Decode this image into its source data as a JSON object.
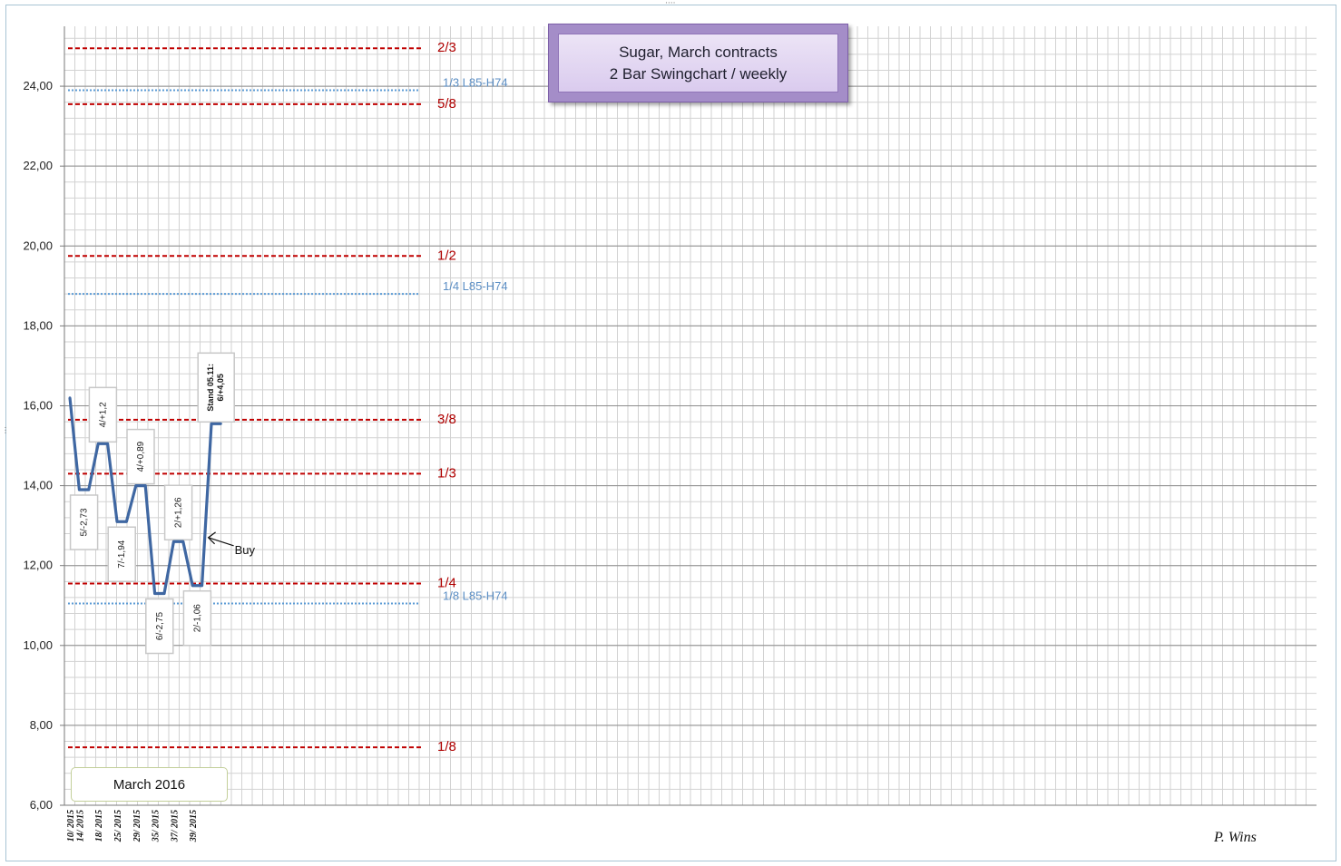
{
  "chart_data": {
    "type": "line",
    "title": "Sugar, March contracts",
    "subtitle": "2 Bar Swingchart / weekly",
    "contract_label": "March 2016",
    "author": "P. Wins",
    "xlabel": "",
    "ylabel": "",
    "ylim": [
      6,
      25.5
    ],
    "y_ticks": [
      "6,00",
      "8,00",
      "10,00",
      "12,00",
      "14,00",
      "16,00",
      "18,00",
      "20,00",
      "22,00",
      "24,00"
    ],
    "y_tick_values": [
      6,
      8,
      10,
      12,
      14,
      16,
      18,
      20,
      22,
      24
    ],
    "x_labels": [
      "10/ 2015",
      "14/ 2015",
      "18/ 2015",
      "25/ 2015",
      "29/ 2015",
      "35/ 2015",
      "37/ 2015",
      "39/ 2015"
    ],
    "x_label_index": [
      0,
      1,
      3,
      5,
      7,
      9,
      11,
      13
    ],
    "grid": true,
    "series": [
      {
        "values": [
          16.2,
          13.9,
          13.9,
          15.05,
          15.05,
          13.1,
          13.1,
          14.0,
          14.0,
          11.3,
          11.3,
          12.6,
          12.6,
          11.5,
          11.5,
          15.55,
          15.55
        ],
        "color": "#3f67a2"
      }
    ],
    "swing_annotations": [
      {
        "text": "5/-2,73",
        "index": 1
      },
      {
        "text": "4/+1,2",
        "index": 3
      },
      {
        "text": "7/-1,94",
        "index": 5
      },
      {
        "text": "4/+0,89",
        "index": 7
      },
      {
        "text": "6/-2,75",
        "index": 9
      },
      {
        "text": "2/+1,26",
        "index": 11
      },
      {
        "text": "2/-1,06",
        "index": 13
      },
      {
        "text": "Stand 05.11:",
        "text2": "6/+4,05",
        "index": 15
      }
    ],
    "buy_annotation": {
      "text": "Buy",
      "value": 12.7
    },
    "reference_lines": [
      {
        "label": "2/3",
        "value": 24.95,
        "style": "dashed",
        "color": "#c00000"
      },
      {
        "label": "1/3 L85-H74",
        "value": 23.9,
        "style": "dotted",
        "color": "#5b9bd5"
      },
      {
        "label": "5/8",
        "value": 23.55,
        "style": "dashed",
        "color": "#c00000"
      },
      {
        "label": "1/2",
        "value": 19.75,
        "style": "dashed",
        "color": "#c00000"
      },
      {
        "label": "1/4 L85-H74",
        "value": 18.8,
        "style": "dotted",
        "color": "#5b9bd5"
      },
      {
        "label": "3/8",
        "value": 15.65,
        "style": "dashed",
        "color": "#c00000"
      },
      {
        "label": "1/3",
        "value": 14.3,
        "style": "dashed",
        "color": "#c00000"
      },
      {
        "label": "1/4",
        "value": 11.55,
        "style": "dashed",
        "color": "#c00000"
      },
      {
        "label": "1/8 L85-H74",
        "value": 11.05,
        "style": "dotted",
        "color": "#5b9bd5"
      },
      {
        "label": "1/8",
        "value": 7.45,
        "style": "dashed",
        "color": "#c00000"
      }
    ]
  }
}
